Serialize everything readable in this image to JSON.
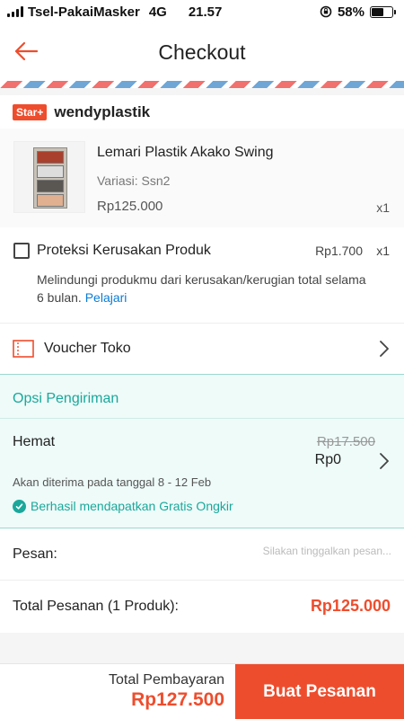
{
  "status_bar": {
    "carrier": "Tsel-PakaiMasker",
    "network": "4G",
    "time": "21.57",
    "battery": "58%",
    "battery_level": 0.58
  },
  "header": {
    "title": "Checkout",
    "back_icon": "arrow-left-icon",
    "accent_color": "#ee4d2d"
  },
  "shop": {
    "badge": "Star+",
    "name": "wendyplastik"
  },
  "product": {
    "name": "Lemari Plastik Akako Swing",
    "variant": "Variasi: Ssn2",
    "price": "Rp125.000",
    "qty": "x1"
  },
  "protection": {
    "label": "Proteksi Kerusakan Produk",
    "price": "Rp1.700",
    "qty": "x1",
    "description": "Melindungi produkmu dari kerusakan/kerugian total selama 6 bulan.",
    "link": "Pelajari",
    "checked": false
  },
  "voucher": {
    "label": "Voucher Toko",
    "icon": "voucher-icon"
  },
  "shipping": {
    "title": "Opsi Pengiriman",
    "method": "Hemat",
    "original_price": "Rp17.500",
    "price": "Rp0",
    "eta": "Akan diterima pada tanggal 8 - 12 Feb",
    "free_shipping": "Berhasil mendapatkan Gratis Ongkir",
    "color": "#1aa89b"
  },
  "message": {
    "label": "Pesan:",
    "placeholder": "Silakan tinggalkan pesan..."
  },
  "order_total": {
    "label": "Total Pesanan (1 Produk):",
    "value": "Rp125.000"
  },
  "footer": {
    "payment_label": "Total Pembayaran",
    "payment_total": "Rp127.500",
    "order_button": "Buat Pesanan"
  }
}
